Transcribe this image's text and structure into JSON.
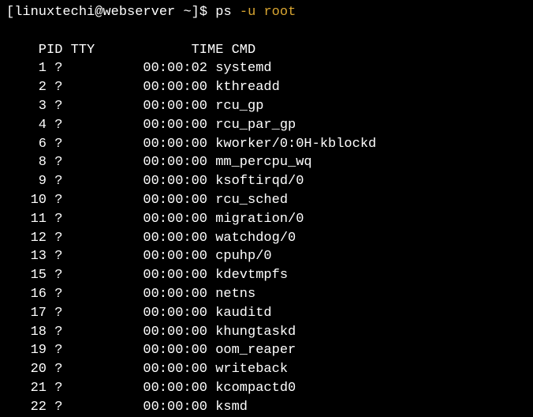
{
  "prompt": {
    "open_bracket": "[",
    "user_host": "linuxtechi@webserver",
    "path": " ~",
    "close_bracket": "]",
    "dollar": "$ ",
    "cmd_part1": "ps ",
    "cmd_part2": "-u root"
  },
  "headers": {
    "pid": "PID",
    "tty": "TTY",
    "time": "TIME",
    "cmd": "CMD"
  },
  "chart_data": {
    "type": "table",
    "rows": [
      {
        "pid": "1",
        "tty": "?",
        "time": "00:00:02",
        "cmd": "systemd"
      },
      {
        "pid": "2",
        "tty": "?",
        "time": "00:00:00",
        "cmd": "kthreadd"
      },
      {
        "pid": "3",
        "tty": "?",
        "time": "00:00:00",
        "cmd": "rcu_gp"
      },
      {
        "pid": "4",
        "tty": "?",
        "time": "00:00:00",
        "cmd": "rcu_par_gp"
      },
      {
        "pid": "6",
        "tty": "?",
        "time": "00:00:00",
        "cmd": "kworker/0:0H-kblockd"
      },
      {
        "pid": "8",
        "tty": "?",
        "time": "00:00:00",
        "cmd": "mm_percpu_wq"
      },
      {
        "pid": "9",
        "tty": "?",
        "time": "00:00:00",
        "cmd": "ksoftirqd/0"
      },
      {
        "pid": "10",
        "tty": "?",
        "time": "00:00:00",
        "cmd": "rcu_sched"
      },
      {
        "pid": "11",
        "tty": "?",
        "time": "00:00:00",
        "cmd": "migration/0"
      },
      {
        "pid": "12",
        "tty": "?",
        "time": "00:00:00",
        "cmd": "watchdog/0"
      },
      {
        "pid": "13",
        "tty": "?",
        "time": "00:00:00",
        "cmd": "cpuhp/0"
      },
      {
        "pid": "15",
        "tty": "?",
        "time": "00:00:00",
        "cmd": "kdevtmpfs"
      },
      {
        "pid": "16",
        "tty": "?",
        "time": "00:00:00",
        "cmd": "netns"
      },
      {
        "pid": "17",
        "tty": "?",
        "time": "00:00:00",
        "cmd": "kauditd"
      },
      {
        "pid": "18",
        "tty": "?",
        "time": "00:00:00",
        "cmd": "khungtaskd"
      },
      {
        "pid": "19",
        "tty": "?",
        "time": "00:00:00",
        "cmd": "oom_reaper"
      },
      {
        "pid": "20",
        "tty": "?",
        "time": "00:00:00",
        "cmd": "writeback"
      },
      {
        "pid": "21",
        "tty": "?",
        "time": "00:00:00",
        "cmd": "kcompactd0"
      },
      {
        "pid": "22",
        "tty": "?",
        "time": "00:00:00",
        "cmd": "ksmd"
      }
    ]
  }
}
